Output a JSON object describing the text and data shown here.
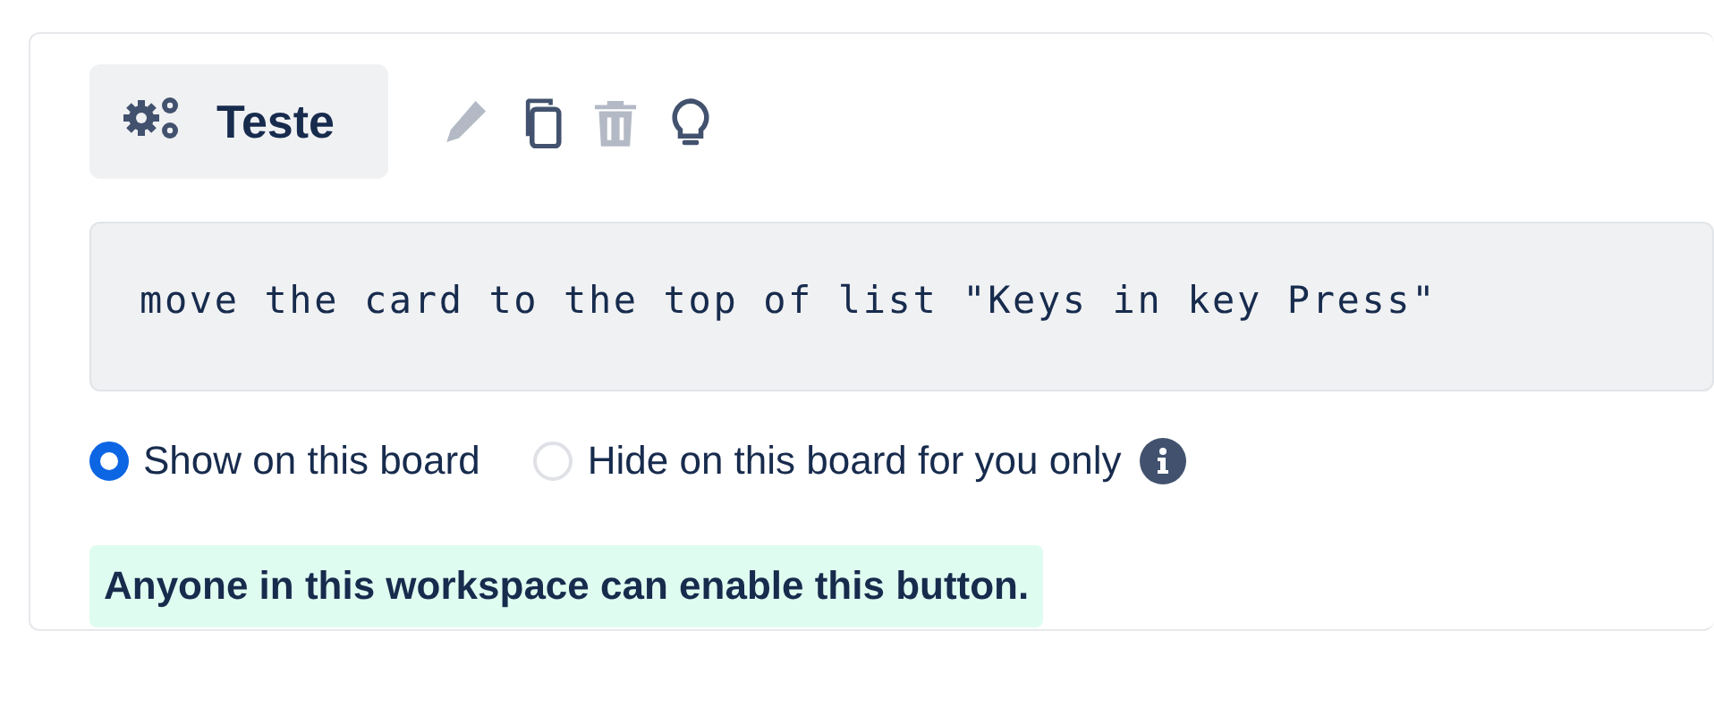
{
  "button": {
    "label": "Teste"
  },
  "actions": [
    {
      "kind": "edit",
      "disabled": true
    },
    {
      "kind": "copy",
      "disabled": false
    },
    {
      "kind": "delete",
      "disabled": true
    },
    {
      "kind": "idea",
      "disabled": false
    }
  ],
  "command": "move the card to the top of list \"Keys in key Press\"",
  "visibility": [
    {
      "label": "Show on this board",
      "selected": true,
      "info": false
    },
    {
      "label": "Hide on this board for you only",
      "selected": false,
      "info": true
    }
  ],
  "notice": "Anyone in this workspace can enable this button."
}
